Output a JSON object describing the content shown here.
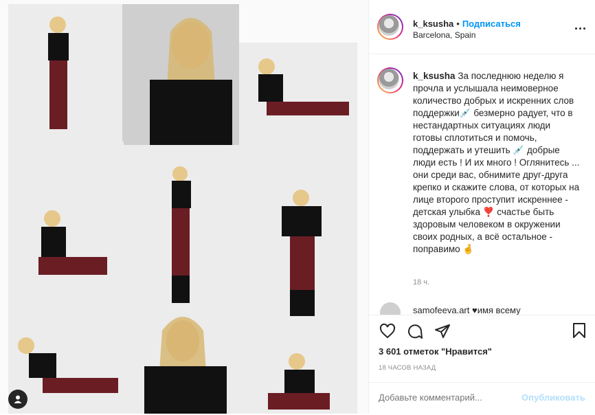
{
  "header": {
    "username": "k_ksusha",
    "separator": "•",
    "follow_label": "Подписаться",
    "location": "Barcelona, Spain"
  },
  "caption": {
    "username": "k_ksusha",
    "text": "За последнюю неделю я прочла и услышала неимоверное количество добрых и искренних слов поддержки💉 безмерно радует, что в нестандартных ситуациях люди готовы сплотиться и помочь, поддержать и утешить 💉 добрые люди есть ! И их много ! Оглянитесь ... они среди вас, обнимите друг-друга крепко и скажите слова, от которых на лице второго проступит искреннее - детская улыбка ❣️ счастье быть здоровым человеком в окружении своих родных, а всё остальное - поправимо 🤞",
    "time_ago": "18 ч."
  },
  "comment_preview": {
    "text": "samofeeva.art ♥имя всему"
  },
  "actions": {
    "likes": "3 601 отметок \"Нравится\"",
    "timestamp": "18 ЧАСОВ НАЗАД",
    "comment_placeholder": "Добавьте комментарий...",
    "post_label": "Опубликовать",
    "icons": [
      "heart-icon",
      "comment-icon",
      "share-icon",
      "bookmark-icon"
    ]
  },
  "colors": {
    "accent": "#0095f6",
    "text": "#262626",
    "muted": "#8e8e8e",
    "post_disabled": "#b2dffc"
  }
}
